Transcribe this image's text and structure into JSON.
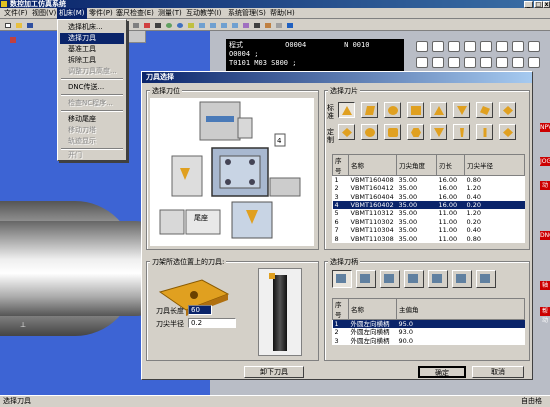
{
  "window": {
    "title": "数控加工仿真系统"
  },
  "menu": {
    "items": [
      "文件(F)",
      "视图(V)",
      "机床(M)",
      "零件(P)",
      "塞尺检查(E)",
      "测量(T)",
      "互动教学(I)",
      "系统管理(S)",
      "帮助(H)"
    ],
    "active_index": 2
  },
  "dropdown": {
    "items": [
      {
        "label": "选择机床...",
        "state": "normal"
      },
      {
        "label": "选择刀具",
        "state": "selected"
      },
      {
        "label": "基准工具",
        "state": "normal"
      },
      {
        "label": "拆除工具",
        "state": "normal"
      },
      {
        "label": "调整刀具高度...",
        "state": "disabled"
      },
      {
        "label": "DNC传送...",
        "state": "normal"
      },
      {
        "label": "检查NC程序...",
        "state": "disabled"
      },
      {
        "label": "移动尾座",
        "state": "normal"
      },
      {
        "label": "移动刀塔",
        "state": "disabled"
      },
      {
        "label": "轨迹显示",
        "state": "disabled"
      },
      {
        "label": "开门",
        "state": "disabled"
      }
    ]
  },
  "cnc": {
    "lcd_line1": "程式          O0004         N 0010",
    "lcd_line2": "O0004 ;",
    "lcd_line3": "T0101 M03 S800 ;",
    "alarm_strips": [
      "NPV",
      "JOG",
      "动",
      "DNC",
      "轴",
      "帮动"
    ]
  },
  "dialog": {
    "title": "刀具选择",
    "tool_position_group": "选择刀位",
    "insert_group": "选择刀片",
    "standard_label": "标准",
    "custom_label": "定制",
    "insert_table": {
      "headers": [
        "序号",
        "名称",
        "刀尖角度",
        "刃长",
        "刀尖半径"
      ],
      "rows": [
        [
          "1",
          "VBMT160408",
          "35.00",
          "16.00",
          "0.80"
        ],
        [
          "2",
          "VBMT160412",
          "35.00",
          "16.00",
          "1.20"
        ],
        [
          "3",
          "VBMT160404",
          "35.00",
          "16.00",
          "0.40"
        ],
        [
          "4",
          "VBMT160402",
          "35.00",
          "16.00",
          "0.20"
        ],
        [
          "5",
          "VBMT110312",
          "35.00",
          "11.00",
          "1.20"
        ],
        [
          "6",
          "VBMT110302",
          "35.00",
          "11.00",
          "0.20"
        ],
        [
          "7",
          "VBMT110304",
          "35.00",
          "11.00",
          "0.40"
        ],
        [
          "8",
          "VBMT110308",
          "35.00",
          "11.00",
          "0.80"
        ]
      ],
      "selected_index": 3
    },
    "holder_group": "选择刀柄",
    "holder_table": {
      "headers": [
        "序号",
        "名称",
        "主偏角"
      ],
      "rows": [
        [
          "1",
          "外圆左向横柄",
          "95.0"
        ],
        [
          "2",
          "外圆左向横柄",
          "93.0"
        ],
        [
          "3",
          "外圆左向横柄",
          "90.0"
        ]
      ],
      "selected_index": 0
    },
    "current_tool_group": "刀架所选位置上的刀具:",
    "tool_length_label": "刀具长度",
    "tool_length_value": "60",
    "nose_radius_label": "刀尖半径",
    "nose_radius_value": "0.2",
    "remove_button": "卸下刀具",
    "ok_button": "确定",
    "cancel_button": "取消",
    "tailstock_label": "尾座",
    "turret_label": "4"
  },
  "status": {
    "text": "选择刀具",
    "right_text": "自由格"
  },
  "colors": {
    "selection": "#0a246a",
    "insert": "#e0a020",
    "dialog_bg": "#d4d0c8"
  }
}
